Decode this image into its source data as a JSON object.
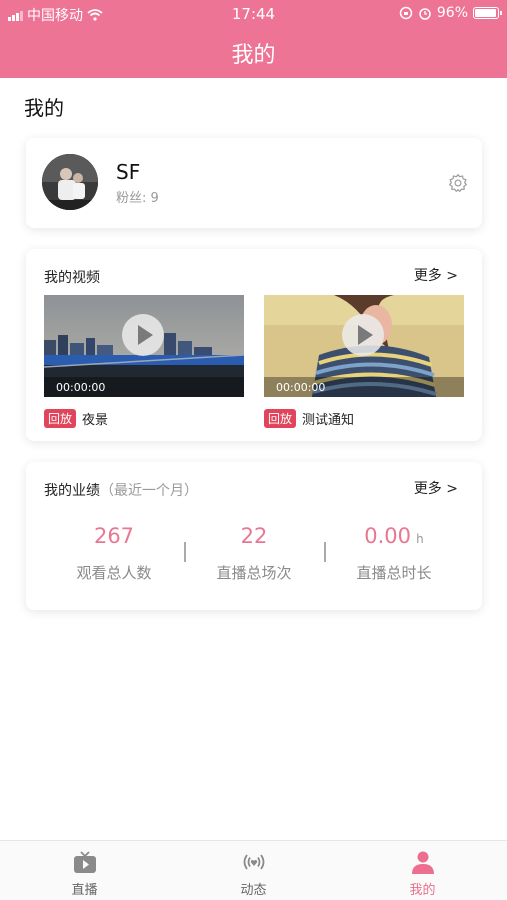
{
  "status_bar": {
    "carrier": "中国移动",
    "time": "17:44",
    "battery": "96%",
    "battery_level": 0.96
  },
  "nav": {
    "title": "我的"
  },
  "page": {
    "heading": "我的"
  },
  "profile": {
    "name": "SF",
    "fans": "粉丝: 9"
  },
  "videos": {
    "title": "我的视频",
    "more": "更多 >",
    "items": [
      {
        "duration": "00:00:00",
        "badge": "回放",
        "title": "夜景"
      },
      {
        "duration": "00:00:00",
        "badge": "回放",
        "title": "测试通知"
      }
    ]
  },
  "performance": {
    "title": "我的业绩",
    "subtitle": "（最近一个月）",
    "more": "更多 >",
    "stats": [
      {
        "value": "267",
        "unit": "",
        "label": "观看总人数"
      },
      {
        "value": "22",
        "unit": "",
        "label": "直播总场次"
      },
      {
        "value": "0.00",
        "unit": "h",
        "label": "直播总时长"
      }
    ]
  },
  "tabs": [
    {
      "label": "直播",
      "icon": "tv-play-icon"
    },
    {
      "label": "动态",
      "icon": "broadcast-heart-icon"
    },
    {
      "label": "我的",
      "icon": "person-icon"
    }
  ],
  "colors": {
    "accent": "#ee7496",
    "stat": "#e97792",
    "badge": "#e0455c"
  }
}
